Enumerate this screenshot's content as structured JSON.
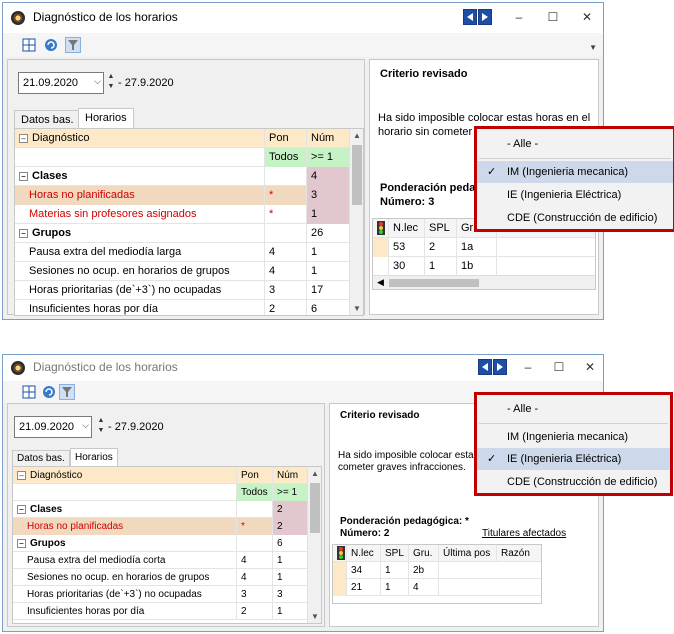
{
  "windows": [
    {
      "title": "Diagnóstico de los horarios",
      "controls": {
        "minimize": "–",
        "maximize": "☐",
        "close": "✕"
      },
      "date_from": "21.09.2020",
      "date_to": "- 27.9.2020",
      "tabs": [
        "Datos bas.",
        "Horarios"
      ],
      "grid": {
        "headers": [
          "Diagnóstico",
          "Pon",
          "Núm"
        ],
        "filter": [
          "Todos",
          ">= 1"
        ],
        "rows": [
          {
            "label": "Clases",
            "pon": "",
            "num": "4",
            "type": "group"
          },
          {
            "label": "Horas no planificadas",
            "pon": "*",
            "num": "3",
            "type": "orange"
          },
          {
            "label": "Materias sin profesores asignados",
            "pon": "*",
            "num": "1",
            "type": "red"
          },
          {
            "label": "Grupos",
            "pon": "",
            "num": "26",
            "type": "group"
          },
          {
            "label": "Pausa extra del mediodía larga",
            "pon": "4",
            "num": "1",
            "type": "item"
          },
          {
            "label": "Sesiones no ocup. en horarios de grupos",
            "pon": "4",
            "num": "1",
            "type": "item"
          },
          {
            "label": "Horas prioritarias (de`+3`) no ocupadas",
            "pon": "3",
            "num": "17",
            "type": "item"
          },
          {
            "label": "Insuficientes horas por día",
            "pon": "2",
            "num": "6",
            "type": "item"
          }
        ]
      },
      "right": {
        "criterio": "Criterio revisado",
        "message_l1": "Ha sido imposible colocar estas horas en el",
        "message_l2": "horario sin cometer gr",
        "ponderacion": "Ponderación peda",
        "numero": "Número: 3",
        "sgrid_headers": [
          "N.lec",
          "SPL",
          "Gr"
        ],
        "sgrid_rows": [
          [
            "53",
            "2",
            "1a"
          ],
          [
            "30",
            "1",
            "1b"
          ]
        ]
      },
      "dropdown": [
        {
          "label": "- Alle -",
          "selected": false
        },
        {
          "label": "IM (Ingenieria mecanica)",
          "selected": true
        },
        {
          "label": "IE (Ingenieria Eléctrica)",
          "selected": false
        },
        {
          "label": "CDE (Construcción de edificio)",
          "selected": false
        }
      ]
    },
    {
      "title": "Diagnóstico de los horarios",
      "controls": {
        "minimize": "–",
        "maximize": "☐",
        "close": "✕"
      },
      "date_from": "21.09.2020",
      "date_to": "- 27.9.2020",
      "tabs": [
        "Datos bas.",
        "Horarios"
      ],
      "grid": {
        "headers": [
          "Diagnóstico",
          "Pon",
          "Núm"
        ],
        "filter": [
          "Todos",
          ">= 1"
        ],
        "rows": [
          {
            "label": "Clases",
            "pon": "",
            "num": "2",
            "type": "group"
          },
          {
            "label": "Horas no planificadas",
            "pon": "*",
            "num": "2",
            "type": "orange"
          },
          {
            "label": "Grupos",
            "pon": "",
            "num": "6",
            "type": "group"
          },
          {
            "label": "Pausa extra del mediodía corta",
            "pon": "4",
            "num": "1",
            "type": "item"
          },
          {
            "label": "Sesiones no ocup. en horarios de grupos",
            "pon": "4",
            "num": "1",
            "type": "item"
          },
          {
            "label": "Horas prioritarias (de`+3`) no ocupadas",
            "pon": "3",
            "num": "3",
            "type": "item"
          },
          {
            "label": "Insuficientes horas por día",
            "pon": "2",
            "num": "1",
            "type": "item"
          }
        ]
      },
      "right": {
        "criterio": "Criterio revisado",
        "message_l1": "Ha sido imposible colocar estas",
        "message_l2": "cometer graves infracciones.",
        "ponderacion": "Ponderación pedagógica: *",
        "numero": "Número: 2",
        "titulares": "Titulares afectados",
        "sgrid_headers": [
          "N.lec",
          "SPL",
          "Gru.",
          "Última pos",
          "Razón"
        ],
        "sgrid_rows": [
          [
            "34",
            "1",
            "2b"
          ],
          [
            "21",
            "1",
            "4"
          ]
        ]
      },
      "dropdown": [
        {
          "label": "- Alle -",
          "selected": false
        },
        {
          "label": "IM (Ingenieria mecanica)",
          "selected": false
        },
        {
          "label": "IE (Ingenieria Eléctrica)",
          "selected": true
        },
        {
          "label": "CDE (Construcción de edificio)",
          "selected": false
        }
      ]
    }
  ]
}
